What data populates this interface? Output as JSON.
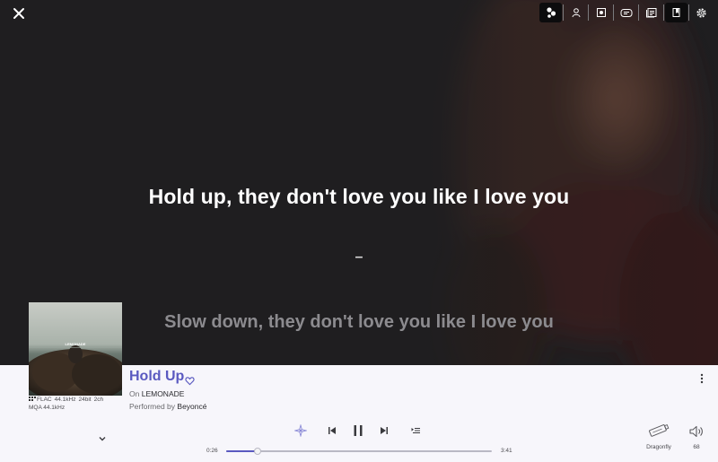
{
  "lyrics": {
    "current": "Hold up, they don't love you like I love you",
    "break": "–",
    "next": "Slow down, they don't love you like I love you"
  },
  "toolbar": {
    "icons": [
      "visualizer-icon",
      "artist-icon",
      "album-icon",
      "queue-icon",
      "library-icon",
      "lyrics-icon",
      "settings-icon"
    ]
  },
  "album_art": {
    "caption": "LEMONADE"
  },
  "track": {
    "title": "Hold Up",
    "album_prefix": "On",
    "album": "LEMONADE",
    "artist_prefix": "Performed by",
    "artist": "Beyoncé"
  },
  "format": {
    "codec": "FLAC",
    "rate": "44.1kHz",
    "bitdepth": "24bit",
    "channels": "2ch",
    "mqa": "MQA 44.1kHz"
  },
  "playback": {
    "elapsed": "0:26",
    "duration": "3:41",
    "progress_fraction": 0.118,
    "state": "playing"
  },
  "output": {
    "device": "Dragonfly",
    "volume": "68"
  },
  "colors": {
    "accent": "#5a59c0",
    "background": "#1f1e20",
    "player_bar": "#f7f6fb"
  }
}
